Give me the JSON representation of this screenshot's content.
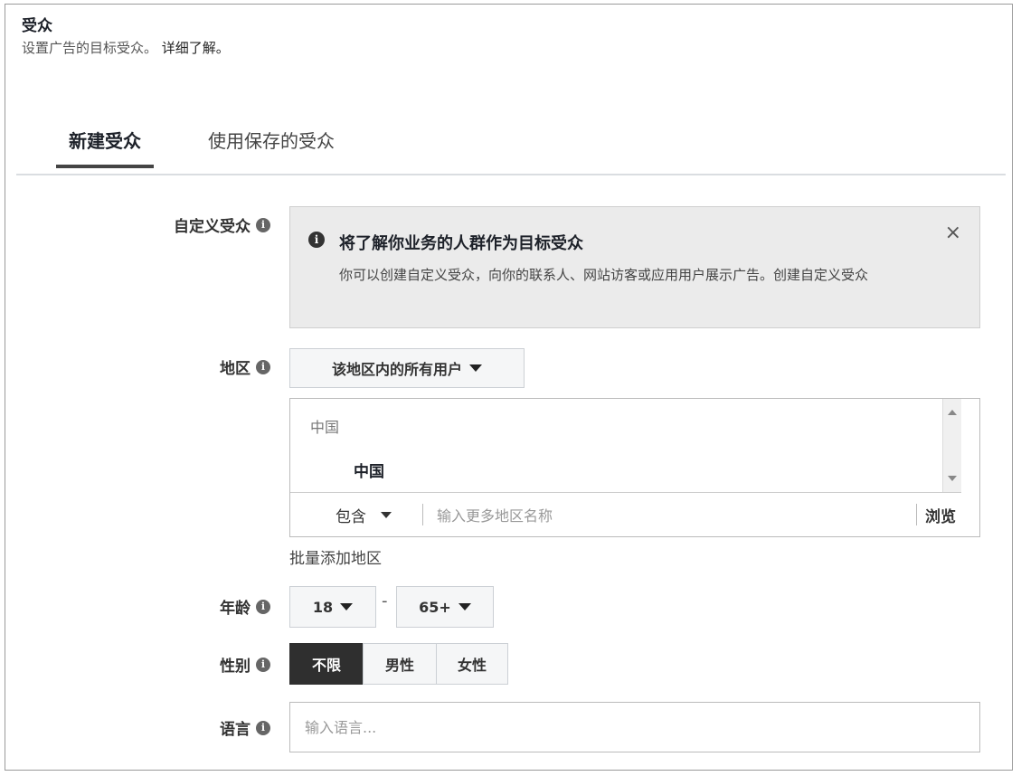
{
  "header": {
    "title": "受众",
    "subtitle": "设置广告的目标受众。",
    "learn_more": "详细了解。"
  },
  "tabs": [
    {
      "label": "新建受众",
      "active": true
    },
    {
      "label": "使用保存的受众",
      "active": false
    }
  ],
  "custom_audience": {
    "label": "自定义受众",
    "notice_title": "将了解你业务的人群作为目标受众",
    "notice_body": "你可以创建自定义受众，向你的联系人、网站访客或应用用户展示广告。创建自定义受众",
    "close_symbol": "×"
  },
  "region": {
    "label": "地区",
    "scope_select": "该地区内的所有用户",
    "list_header": "中国",
    "list_items": [
      "中国"
    ],
    "include_select": "包含",
    "input_placeholder": "输入更多地区名称",
    "browse_label": "浏览",
    "bulk_add": "批量添加地区"
  },
  "age": {
    "label": "年龄",
    "min": "18",
    "separator": "-",
    "max": "65+"
  },
  "gender": {
    "label": "性别",
    "options": [
      "不限",
      "男性",
      "女性"
    ],
    "selected": "不限"
  },
  "language": {
    "label": "语言",
    "placeholder": "输入语言..."
  },
  "icons": {
    "info": "info-icon",
    "close": "close-icon",
    "dropdown": "caret-down-icon"
  }
}
